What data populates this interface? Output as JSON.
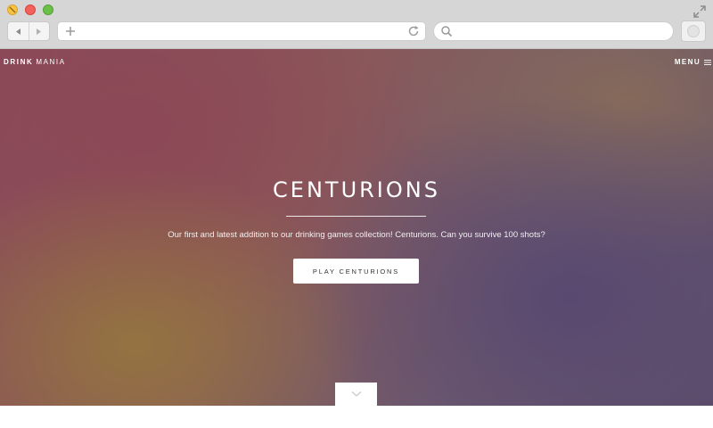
{
  "browser": {
    "traffic_lights": [
      "minimize",
      "close",
      "zoom"
    ],
    "back_icon": "back-arrow-icon",
    "forward_icon": "forward-arrow-icon",
    "new_tab_icon": "plus-icon",
    "reload_icon": "reload-icon",
    "search_icon": "search-icon",
    "url": "",
    "search_value": "",
    "colors": {
      "chrome": "#d6d6d6",
      "close": "#f2615a",
      "minimize": "#f5c342",
      "zoom": "#6cc04a"
    }
  },
  "site": {
    "brand_bold": "DRINK",
    "brand_light": "MANIA",
    "menu_label": "MENU",
    "menu_icon": "hamburger-icon"
  },
  "hero": {
    "title": "CENTURIONS",
    "subtitle": "Our first and latest addition to our drinking games collection! Centurions. Can you survive 100 shots?",
    "cta_label": "PLAY CENTURIONS",
    "scroll_icon": "chevron-down-icon"
  }
}
